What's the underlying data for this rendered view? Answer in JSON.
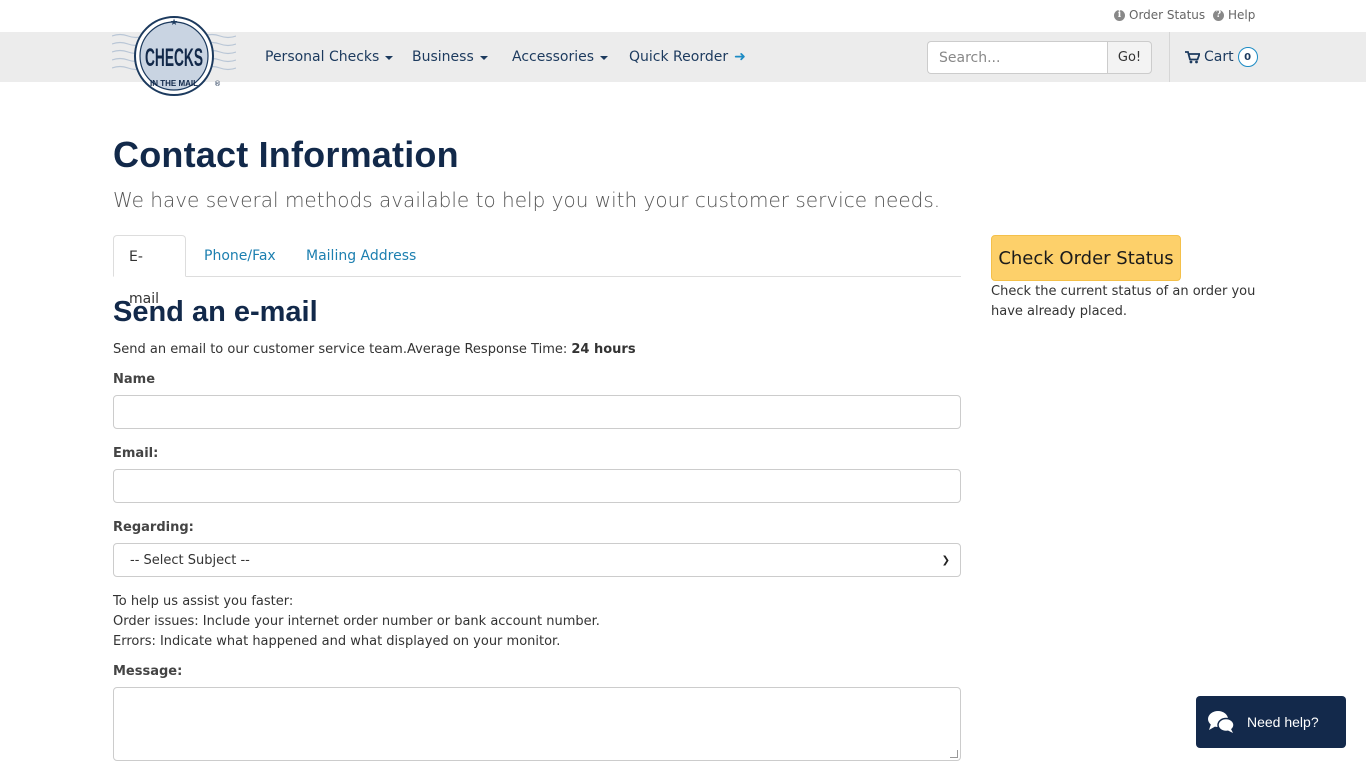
{
  "utility": {
    "order_status": "Order Status",
    "help": "Help"
  },
  "logo": {
    "text": "CHECKS",
    "tagline": "IN THE MAIL",
    "mark": "®"
  },
  "nav": {
    "items": [
      {
        "label": "Personal Checks"
      },
      {
        "label": "Business"
      },
      {
        "label": "Accessories"
      },
      {
        "label": "Quick Reorder"
      }
    ],
    "search_placeholder": "Search...",
    "search_button": "Go!",
    "cart_label": "Cart",
    "cart_count": "0"
  },
  "main": {
    "title": "Contact Information",
    "subtitle": "We have several methods available to help you with your customer service needs.",
    "tabs": [
      {
        "label": "E-mail"
      },
      {
        "label": "Phone/Fax"
      },
      {
        "label": "Mailing Address"
      }
    ],
    "section_title": "Send an e-mail",
    "intro_text": "Send an email to our customer service team.Average Response Time: ",
    "intro_bold": "24 hours",
    "form": {
      "name_label": "Name",
      "email_label": "Email:",
      "regarding_label": "Regarding:",
      "regarding_value": "-- Select Subject --",
      "help_lines": [
        "To help us assist you faster:",
        "Order issues: Include your internet order number or bank account number.",
        "Errors: Indicate what happened and what displayed on your monitor."
      ],
      "message_label": "Message:"
    }
  },
  "sidebar": {
    "button_label": "Check Order Status",
    "description": "Check the current status of an order you have already placed."
  },
  "chat": {
    "label": "Need help?"
  },
  "colors": {
    "navy": "#12294a",
    "link": "#1c7fb0",
    "button_yellow": "#fdd06a",
    "nav_bg": "#ececec"
  }
}
